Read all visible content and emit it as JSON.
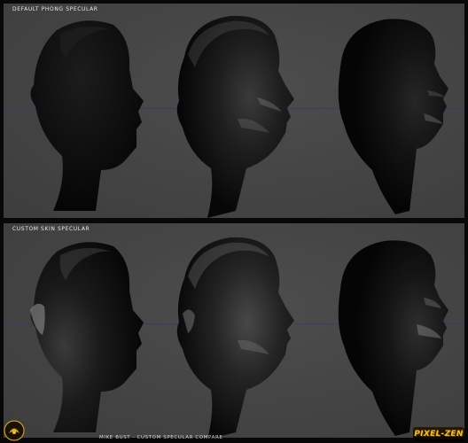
{
  "panels": [
    {
      "id": "top",
      "label": "DEFAULT PHONG SPECULAR"
    },
    {
      "id": "bottom",
      "label": "CUSTOM SKIN SPECULAR"
    }
  ],
  "footer": {
    "caption": "MIKE BUST - CUSTOM SPECULAR COMPARE",
    "logo_text": "PIXEL-ZEN"
  },
  "colors": {
    "background": "#080808",
    "viewport": "#444444",
    "horizon_line": "#3a3a6e",
    "label_text": "#e8e8e8",
    "logo_accent": "#f0c020"
  }
}
